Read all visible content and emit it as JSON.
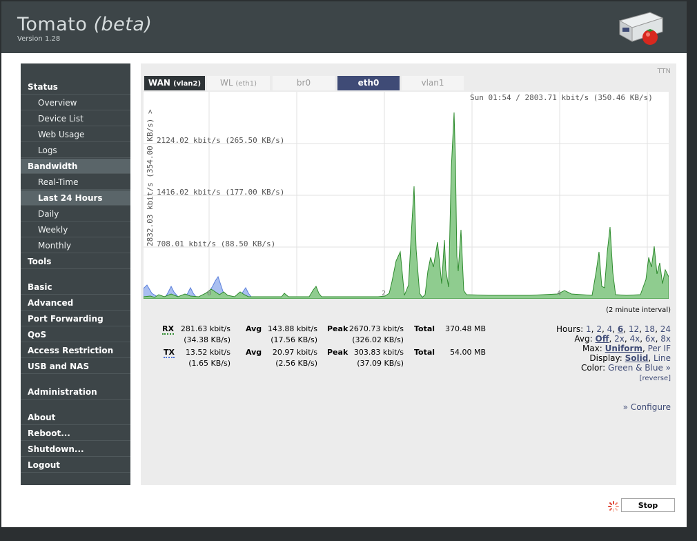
{
  "header": {
    "title": "Tomato",
    "title_beta": "(beta)",
    "version": "Version 1.28"
  },
  "sidebar": {
    "items": [
      {
        "label": "Status",
        "level": "top",
        "y": 0
      },
      {
        "label": "Overview",
        "level": "sub"
      },
      {
        "label": "Device List",
        "level": "sub"
      },
      {
        "label": "Web Usage",
        "level": "sub"
      },
      {
        "label": "Logs",
        "level": "sub"
      },
      {
        "label": "Bandwidth",
        "level": "top",
        "active": true
      },
      {
        "label": "Real-Time",
        "level": "sub"
      },
      {
        "label": "Last 24 Hours",
        "level": "sub",
        "active": true
      },
      {
        "label": "Daily",
        "level": "sub"
      },
      {
        "label": "Weekly",
        "level": "sub"
      },
      {
        "label": "Monthly",
        "level": "sub"
      },
      {
        "label": "Tools",
        "level": "top"
      },
      {
        "label": "Basic",
        "level": "top"
      },
      {
        "label": "Advanced",
        "level": "top"
      },
      {
        "label": "Port Forwarding",
        "level": "top"
      },
      {
        "label": "QoS",
        "level": "top"
      },
      {
        "label": "Access Restriction",
        "level": "top"
      },
      {
        "label": "USB and NAS",
        "level": "top"
      },
      {
        "label": "Administration",
        "level": "top"
      },
      {
        "label": "About",
        "level": "top"
      },
      {
        "label": "Reboot...",
        "level": "top"
      },
      {
        "label": "Shutdown...",
        "level": "top"
      },
      {
        "label": "Logout",
        "level": "top"
      }
    ]
  },
  "ttn": "TTN",
  "tabs": [
    {
      "label": "WAN",
      "sub": "(vlan2)"
    },
    {
      "label": "WL",
      "sub": "(eth1)"
    },
    {
      "label": "br0",
      "sub": ""
    },
    {
      "label": "eth0",
      "sub": ""
    },
    {
      "label": "vlan1",
      "sub": ""
    }
  ],
  "graph": {
    "status": "Sun 01:54 / 2803.71 kbit/s (350.46 KB/s)",
    "y_axis_label": "2832.03 kbit/s (354.00 KB/s) >",
    "gridlines": [
      "2124.02 kbit/s (265.50 KB/s)",
      "1416.02 kbit/s (177.00 KB/s)",
      "708.01 kbit/s (88.50 KB/s)"
    ],
    "hour_labels": [
      "0",
      "2",
      "4"
    ],
    "rx_color": "#2e9a2e",
    "tx_color": "#5b7fdc"
  },
  "interval": "(2 minute interval)",
  "stats": {
    "rx": {
      "name": "RX",
      "cur": "281.63 kbit/s",
      "cur_kb": "(34.38 KB/s)",
      "avg": "143.88 kbit/s",
      "avg_kb": "(17.56 KB/s)",
      "peak": "2670.73 kbit/s",
      "peak_kb": "(326.02 KB/s)",
      "total": "370.48 MB"
    },
    "tx": {
      "name": "TX",
      "cur": "13.52 kbit/s",
      "cur_kb": "(1.65 KB/s)",
      "avg": "20.97 kbit/s",
      "avg_kb": "(2.56 KB/s)",
      "peak": "303.83 kbit/s",
      "peak_kb": "(37.09 KB/s)",
      "total": "54.00 MB"
    },
    "avg_label": "Avg",
    "peak_label": "Peak",
    "total_label": "Total"
  },
  "options": {
    "hours_label": "Hours:",
    "hours": [
      "1",
      "2",
      "4",
      "6",
      "12",
      "18",
      "24"
    ],
    "hours_selected": "6",
    "avg_label": "Avg:",
    "avg": [
      "Off",
      "2x",
      "4x",
      "6x",
      "8x"
    ],
    "avg_selected": "Off",
    "max_label": "Max:",
    "max": [
      "Uniform",
      "Per IF"
    ],
    "max_selected": "Uniform",
    "display_label": "Display:",
    "display": [
      "Solid",
      "Line"
    ],
    "display_selected": "Solid",
    "color_label": "Color:",
    "color_value": "Green & Blue »",
    "reverse": "[reverse]"
  },
  "configure": "» Configure",
  "stop_button": "Stop"
}
